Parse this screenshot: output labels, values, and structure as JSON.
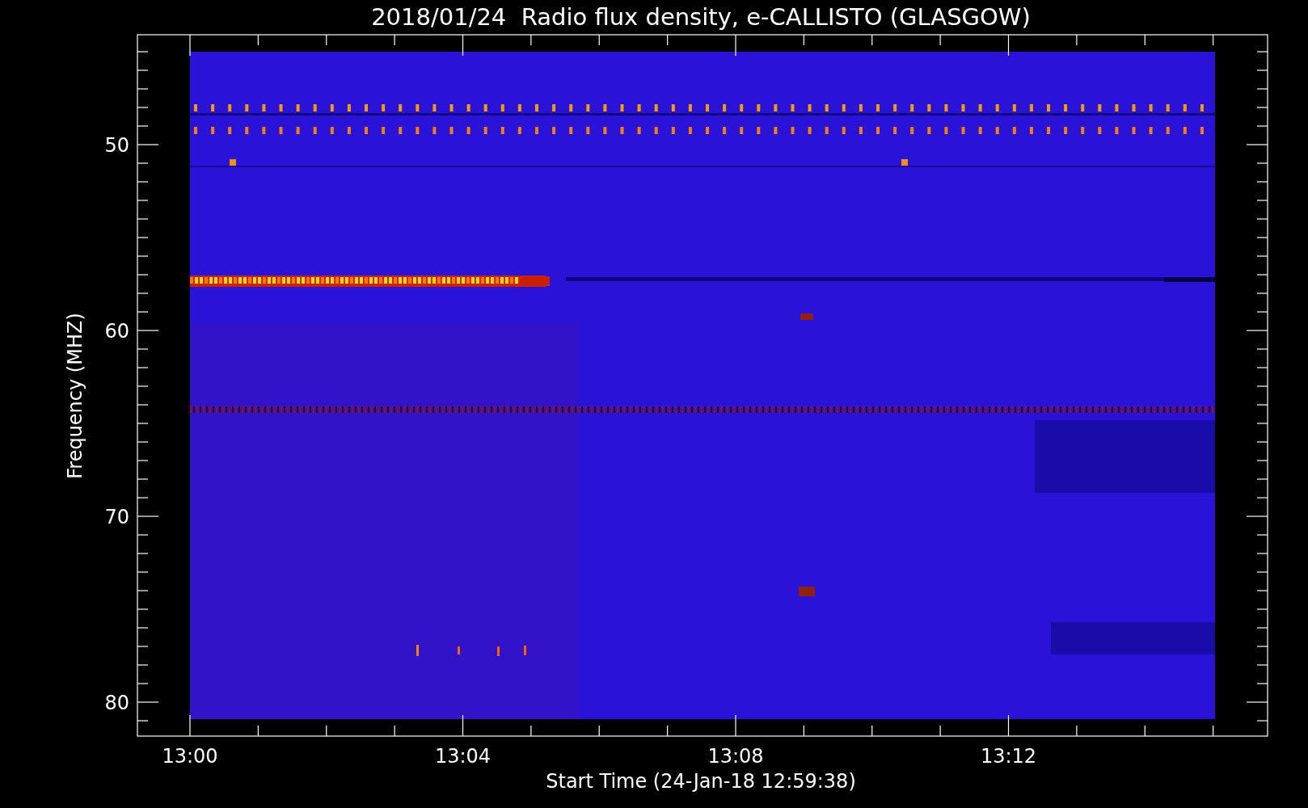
{
  "chart": {
    "title": "2018/01/24  Radio flux density, e-CALLISTO (GLASGOW)",
    "y_axis": {
      "label": "Frequency (MHZ)",
      "ticks": [
        "50",
        "60",
        "70",
        "80"
      ]
    },
    "x_axis": {
      "label": "Start Time (24-Jan-18 12:59:38)",
      "ticks": [
        "13:00",
        "13:04",
        "13:08",
        "13:12"
      ]
    }
  }
}
